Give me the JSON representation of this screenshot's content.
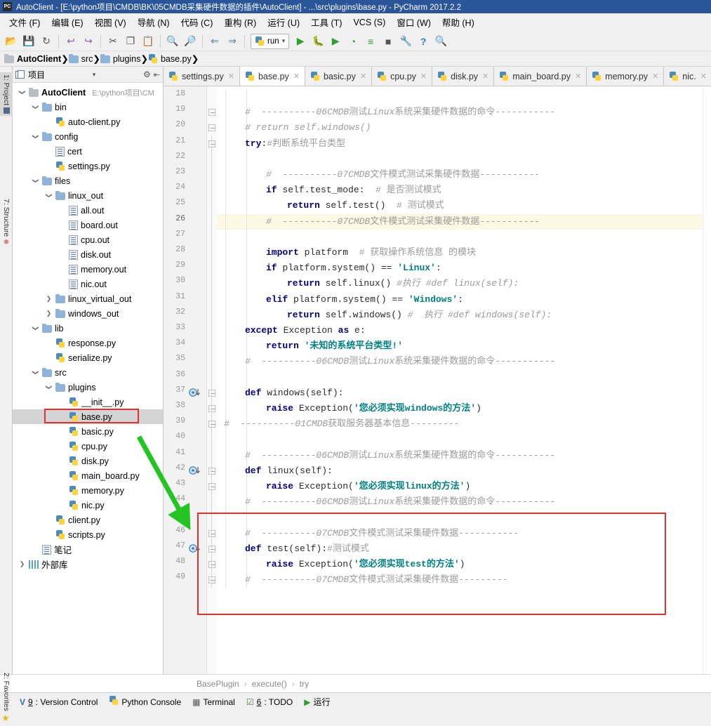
{
  "window": {
    "title": "AutoClient - [E:\\python项目\\CMDB\\BK\\05CMDB采集硬件数据的插件\\AutoClient] - ...\\src\\plugins\\base.py - PyCharm 2017.2.2",
    "app_badge": "PC"
  },
  "menubar": {
    "items": [
      {
        "label": "文件 (F)"
      },
      {
        "label": "编辑 (E)"
      },
      {
        "label": "视图 (V)"
      },
      {
        "label": "导航 (N)"
      },
      {
        "label": "代码 (C)"
      },
      {
        "label": "重构 (R)"
      },
      {
        "label": "运行 (U)"
      },
      {
        "label": "工具 (T)"
      },
      {
        "label": "VCS (S)"
      },
      {
        "label": "窗口 (W)"
      },
      {
        "label": "帮助 (H)"
      }
    ]
  },
  "toolbar": {
    "run_config_label": "run",
    "icons": [
      {
        "name": "open-folder-icon",
        "glyph": "📂"
      },
      {
        "name": "save-all-icon",
        "glyph": "💾"
      },
      {
        "name": "sync-icon",
        "glyph": "↻"
      },
      {
        "name": "undo-icon",
        "glyph": "↩"
      },
      {
        "name": "redo-icon",
        "glyph": "↪"
      },
      {
        "name": "cut-icon",
        "glyph": "✂"
      },
      {
        "name": "copy-icon",
        "glyph": "❐"
      },
      {
        "name": "paste-icon",
        "glyph": "📋"
      },
      {
        "name": "find-icon",
        "glyph": "🔍"
      },
      {
        "name": "replace-icon",
        "glyph": "🔎"
      },
      {
        "name": "back-icon",
        "glyph": "⇐"
      },
      {
        "name": "forward-icon",
        "glyph": "⇒"
      },
      {
        "name": "run-icon",
        "glyph": "▶"
      },
      {
        "name": "debug-icon",
        "glyph": "🐛"
      },
      {
        "name": "run-coverage-icon",
        "glyph": "▶"
      },
      {
        "name": "profile-icon",
        "glyph": "◔"
      },
      {
        "name": "run-with-params-icon",
        "glyph": "≡"
      },
      {
        "name": "stop-icon",
        "glyph": "■"
      },
      {
        "name": "settings-wrench-icon",
        "glyph": "🔧"
      },
      {
        "name": "help-icon",
        "glyph": "?"
      },
      {
        "name": "search-everywhere-icon",
        "glyph": "🔍"
      }
    ]
  },
  "breadcrumb": {
    "items": [
      {
        "label": "AutoClient",
        "icon": "folder-icon",
        "bold": true
      },
      {
        "label": "src",
        "icon": "folder-icon",
        "bold": false
      },
      {
        "label": "plugins",
        "icon": "folder-icon",
        "bold": false
      },
      {
        "label": "base.py",
        "icon": "python-file-icon",
        "bold": false
      }
    ]
  },
  "left_tool_strip": {
    "items": [
      {
        "label": "1: Project",
        "selected": true
      },
      {
        "label": "7: Structure",
        "selected": false
      },
      {
        "label": "2: Favorites",
        "selected": false
      }
    ]
  },
  "project_panel": {
    "header_title": "项目",
    "header_icons": [
      "project-view-icon",
      "chevron-down-icon",
      "gear-icon",
      "collapse-all-icon"
    ],
    "tree": [
      {
        "depth": 0,
        "label": "AutoClient",
        "path": "E:\\python项目\\CM",
        "icon": "folder-icon",
        "arrow": "open",
        "bold": true
      },
      {
        "depth": 1,
        "label": "bin",
        "icon": "folder-blue-icon",
        "arrow": "open"
      },
      {
        "depth": 2,
        "label": "auto-client.py",
        "icon": "python-file-icon",
        "arrow": "none"
      },
      {
        "depth": 1,
        "label": "config",
        "icon": "folder-blue-icon",
        "arrow": "open"
      },
      {
        "depth": 2,
        "label": "cert",
        "icon": "text-file-icon",
        "arrow": "none"
      },
      {
        "depth": 2,
        "label": "settings.py",
        "icon": "python-file-icon",
        "arrow": "none"
      },
      {
        "depth": 1,
        "label": "files",
        "icon": "folder-blue-icon",
        "arrow": "open"
      },
      {
        "depth": 2,
        "label": "linux_out",
        "icon": "folder-blue-icon",
        "arrow": "open"
      },
      {
        "depth": 3,
        "label": "all.out",
        "icon": "text-file-icon",
        "arrow": "none"
      },
      {
        "depth": 3,
        "label": "board.out",
        "icon": "text-file-icon",
        "arrow": "none"
      },
      {
        "depth": 3,
        "label": "cpu.out",
        "icon": "text-file-icon",
        "arrow": "none"
      },
      {
        "depth": 3,
        "label": "disk.out",
        "icon": "text-file-icon",
        "arrow": "none"
      },
      {
        "depth": 3,
        "label": "memory.out",
        "icon": "text-file-icon",
        "arrow": "none"
      },
      {
        "depth": 3,
        "label": "nic.out",
        "icon": "text-file-icon",
        "arrow": "none"
      },
      {
        "depth": 2,
        "label": "linux_virtual_out",
        "icon": "folder-blue-icon",
        "arrow": "closed"
      },
      {
        "depth": 2,
        "label": "windows_out",
        "icon": "folder-blue-icon",
        "arrow": "closed"
      },
      {
        "depth": 1,
        "label": "lib",
        "icon": "folder-blue-icon",
        "arrow": "open"
      },
      {
        "depth": 2,
        "label": "response.py",
        "icon": "python-file-icon",
        "arrow": "none"
      },
      {
        "depth": 2,
        "label": "serialize.py",
        "icon": "python-file-icon",
        "arrow": "none"
      },
      {
        "depth": 1,
        "label": "src",
        "icon": "folder-blue-icon",
        "arrow": "open"
      },
      {
        "depth": 2,
        "label": "plugins",
        "icon": "folder-blue-icon",
        "arrow": "open"
      },
      {
        "depth": 3,
        "label": "__init__.py",
        "icon": "python-file-icon",
        "arrow": "none"
      },
      {
        "depth": 3,
        "label": "base.py",
        "icon": "python-file-icon",
        "arrow": "none",
        "selected": true,
        "highlighted": true
      },
      {
        "depth": 3,
        "label": "basic.py",
        "icon": "python-file-icon",
        "arrow": "none"
      },
      {
        "depth": 3,
        "label": "cpu.py",
        "icon": "python-file-icon",
        "arrow": "none"
      },
      {
        "depth": 3,
        "label": "disk.py",
        "icon": "python-file-icon",
        "arrow": "none"
      },
      {
        "depth": 3,
        "label": "main_board.py",
        "icon": "python-file-icon",
        "arrow": "none"
      },
      {
        "depth": 3,
        "label": "memory.py",
        "icon": "python-file-icon",
        "arrow": "none"
      },
      {
        "depth": 3,
        "label": "nic.py",
        "icon": "python-file-icon",
        "arrow": "none"
      },
      {
        "depth": 2,
        "label": "client.py",
        "icon": "python-file-icon",
        "arrow": "none"
      },
      {
        "depth": 2,
        "label": "scripts.py",
        "icon": "python-file-icon",
        "arrow": "none"
      },
      {
        "depth": 1,
        "label": "笔记",
        "icon": "text-file-icon",
        "arrow": "none"
      },
      {
        "depth": 0,
        "label": "外部库",
        "icon": "library-icon",
        "arrow": "closed"
      }
    ]
  },
  "editor_tabs": [
    {
      "label": "settings.py",
      "active": false
    },
    {
      "label": "base.py",
      "active": true
    },
    {
      "label": "basic.py",
      "active": false
    },
    {
      "label": "cpu.py",
      "active": false
    },
    {
      "label": "disk.py",
      "active": false
    },
    {
      "label": "main_board.py",
      "active": false
    },
    {
      "label": "memory.py",
      "active": false
    },
    {
      "label": "nic.",
      "active": false
    }
  ],
  "editor": {
    "first_line": 18,
    "last_line": 49,
    "highlighted_line": 26,
    "override_marker_lines": [
      37,
      42,
      47
    ],
    "lines": [
      {
        "n": 18,
        "tokens": []
      },
      {
        "n": 19,
        "tokens": [
          {
            "t": "#  ----------",
            "c": "cm"
          },
          {
            "t": "06CMDB",
            "c": "cm"
          },
          {
            "t": "测试",
            "c": "cm-cn"
          },
          {
            "t": "Linux",
            "c": "cm"
          },
          {
            "t": "系统采集硬件数据的命令",
            "c": "cm-cn"
          },
          {
            "t": "-----------",
            "c": "cm"
          }
        ],
        "indent": 1
      },
      {
        "n": 20,
        "tokens": [
          {
            "t": "# return self.windows()",
            "c": "cm"
          }
        ],
        "indent": 1
      },
      {
        "n": 21,
        "tokens": [
          {
            "t": "try",
            "c": "kw"
          },
          {
            "t": ":",
            "c": "pl"
          },
          {
            "t": "#判断系统平台类型",
            "c": "cm-cn"
          }
        ],
        "indent": 1
      },
      {
        "n": 22,
        "tokens": []
      },
      {
        "n": 23,
        "tokens": [
          {
            "t": "#  ----------",
            "c": "cm"
          },
          {
            "t": "07CMDB",
            "c": "cm"
          },
          {
            "t": "文件模式测试采集硬件数据",
            "c": "cm-cn"
          },
          {
            "t": "-----------",
            "c": "cm"
          }
        ],
        "indent": 2
      },
      {
        "n": 24,
        "tokens": [
          {
            "t": "if",
            "c": "kw"
          },
          {
            "t": " self.test_mode:  ",
            "c": "pl"
          },
          {
            "t": "# 是否测试模式",
            "c": "cm-cn"
          }
        ],
        "indent": 2
      },
      {
        "n": 25,
        "tokens": [
          {
            "t": "return",
            "c": "kw"
          },
          {
            "t": " self.test()  ",
            "c": "pl"
          },
          {
            "t": "# 测试模式",
            "c": "cm-cn"
          }
        ],
        "indent": 3
      },
      {
        "n": 26,
        "tokens": [
          {
            "t": "#  ----------",
            "c": "cm"
          },
          {
            "t": "07CMDB",
            "c": "cm"
          },
          {
            "t": "文件模式测试采集硬件数据",
            "c": "cm-cn"
          },
          {
            "t": "-----------",
            "c": "cm"
          }
        ],
        "indent": 2
      },
      {
        "n": 27,
        "tokens": []
      },
      {
        "n": 28,
        "tokens": [
          {
            "t": "import",
            "c": "kw"
          },
          {
            "t": " platform  ",
            "c": "pl"
          },
          {
            "t": "# 获取操作系统信息 的模块",
            "c": "cm-cn"
          }
        ],
        "indent": 2
      },
      {
        "n": 29,
        "tokens": [
          {
            "t": "if",
            "c": "kw"
          },
          {
            "t": " platform.system() == ",
            "c": "pl"
          },
          {
            "t": "'Linux'",
            "c": "st"
          },
          {
            "t": ":",
            "c": "pl"
          }
        ],
        "indent": 2
      },
      {
        "n": 30,
        "tokens": [
          {
            "t": "return",
            "c": "kw"
          },
          {
            "t": " self.linux() ",
            "c": "pl"
          },
          {
            "t": "#执行 #def linux(self):",
            "c": "cm"
          }
        ],
        "indent": 3
      },
      {
        "n": 31,
        "tokens": [
          {
            "t": "elif",
            "c": "kw"
          },
          {
            "t": " platform.system() == ",
            "c": "pl"
          },
          {
            "t": "'Windows'",
            "c": "st"
          },
          {
            "t": ":",
            "c": "pl"
          }
        ],
        "indent": 2
      },
      {
        "n": 32,
        "tokens": [
          {
            "t": "return",
            "c": "kw"
          },
          {
            "t": " self.windows() ",
            "c": "pl"
          },
          {
            "t": "#  执行 #def windows(self):",
            "c": "cm"
          }
        ],
        "indent": 3
      },
      {
        "n": 33,
        "tokens": [
          {
            "t": "except",
            "c": "kw"
          },
          {
            "t": " Exception ",
            "c": "pl"
          },
          {
            "t": "as",
            "c": "kw"
          },
          {
            "t": " e:",
            "c": "pl"
          }
        ],
        "indent": 1
      },
      {
        "n": 34,
        "tokens": [
          {
            "t": "return",
            "c": "kw"
          },
          {
            "t": " ",
            "c": "pl"
          },
          {
            "t": "'未知的系统平台类型!'",
            "c": "st"
          }
        ],
        "indent": 2
      },
      {
        "n": 35,
        "tokens": [
          {
            "t": "#  ----------",
            "c": "cm"
          },
          {
            "t": "06CMDB",
            "c": "cm"
          },
          {
            "t": "测试",
            "c": "cm-cn"
          },
          {
            "t": "Linux",
            "c": "cm"
          },
          {
            "t": "系统采集硬件数据的命令",
            "c": "cm-cn"
          },
          {
            "t": "-----------",
            "c": "cm"
          }
        ],
        "indent": 1
      },
      {
        "n": 36,
        "tokens": []
      },
      {
        "n": 37,
        "tokens": [
          {
            "t": "def",
            "c": "kw"
          },
          {
            "t": " windows(self):",
            "c": "pl"
          }
        ],
        "indent": 1
      },
      {
        "n": 38,
        "tokens": [
          {
            "t": "raise",
            "c": "kw"
          },
          {
            "t": " Exception(",
            "c": "pl"
          },
          {
            "t": "'您必须实现windows的方法'",
            "c": "st"
          },
          {
            "t": ")",
            "c": "pl"
          }
        ],
        "indent": 2
      },
      {
        "n": 39,
        "tokens": [
          {
            "t": "#  ----------",
            "c": "cm"
          },
          {
            "t": "01CMDB",
            "c": "cm"
          },
          {
            "t": "获取服务器基本信息",
            "c": "cm-cn"
          },
          {
            "t": "---------",
            "c": "cm"
          }
        ],
        "indent": 0
      },
      {
        "n": 40,
        "tokens": []
      },
      {
        "n": 41,
        "tokens": [
          {
            "t": "#  ----------",
            "c": "cm"
          },
          {
            "t": "06CMDB",
            "c": "cm"
          },
          {
            "t": "测试",
            "c": "cm-cn"
          },
          {
            "t": "Linux",
            "c": "cm"
          },
          {
            "t": "系统采集硬件数据的命令",
            "c": "cm-cn"
          },
          {
            "t": "-----------",
            "c": "cm"
          }
        ],
        "indent": 1
      },
      {
        "n": 42,
        "tokens": [
          {
            "t": "def",
            "c": "kw"
          },
          {
            "t": " linux(self):",
            "c": "pl"
          }
        ],
        "indent": 1
      },
      {
        "n": 43,
        "tokens": [
          {
            "t": "raise",
            "c": "kw"
          },
          {
            "t": " Exception(",
            "c": "pl"
          },
          {
            "t": "'您必须实现linux的方法'",
            "c": "st"
          },
          {
            "t": ")",
            "c": "pl"
          }
        ],
        "indent": 2
      },
      {
        "n": 44,
        "tokens": [
          {
            "t": "#  ----------",
            "c": "cm"
          },
          {
            "t": "06CMDB",
            "c": "cm"
          },
          {
            "t": "测试",
            "c": "cm-cn"
          },
          {
            "t": "Linux",
            "c": "cm"
          },
          {
            "t": "系统采集硬件数据的命令",
            "c": "cm-cn"
          },
          {
            "t": "-----------",
            "c": "cm"
          }
        ],
        "indent": 1
      },
      {
        "n": 45,
        "tokens": []
      },
      {
        "n": 46,
        "tokens": [
          {
            "t": "#  ----------",
            "c": "cm"
          },
          {
            "t": "07CMDB",
            "c": "cm"
          },
          {
            "t": "文件模式测试采集硬件数据",
            "c": "cm-cn"
          },
          {
            "t": "-----------",
            "c": "cm"
          }
        ],
        "indent": 1
      },
      {
        "n": 47,
        "tokens": [
          {
            "t": "def",
            "c": "kw"
          },
          {
            "t": " test(self):",
            "c": "pl"
          },
          {
            "t": "#测试模式",
            "c": "cm-cn"
          }
        ],
        "indent": 1
      },
      {
        "n": 48,
        "tokens": [
          {
            "t": "raise",
            "c": "kw"
          },
          {
            "t": " Exception(",
            "c": "pl"
          },
          {
            "t": "'您必须实现test的方法'",
            "c": "st"
          },
          {
            "t": ")",
            "c": "pl"
          }
        ],
        "indent": 2
      },
      {
        "n": 49,
        "tokens": [
          {
            "t": "#  ----------",
            "c": "cm"
          },
          {
            "t": "07CMDB",
            "c": "cm"
          },
          {
            "t": "文件模式测试采集硬件数据",
            "c": "cm-cn"
          },
          {
            "t": "---------",
            "c": "cm"
          }
        ],
        "indent": 1
      }
    ]
  },
  "navigation_bar": {
    "items": [
      "BasePlugin",
      "execute()",
      "try"
    ],
    "separator": "›"
  },
  "status_bar": {
    "items": [
      {
        "icon": "version-control-icon",
        "num": "9",
        "label": ": Version Control"
      },
      {
        "icon": "python-console-icon",
        "num": "",
        "label": "Python Console"
      },
      {
        "icon": "terminal-icon",
        "num": "",
        "label": "Terminal"
      },
      {
        "icon": "todo-icon",
        "num": "6",
        "label": ": TODO"
      },
      {
        "icon": "run-icon",
        "num": "",
        "label": "运行"
      }
    ]
  },
  "annotations": {
    "tree_highlight_color": "#e03131",
    "code_highlight_color": "#e03131",
    "arrow_color": "#22c522"
  }
}
